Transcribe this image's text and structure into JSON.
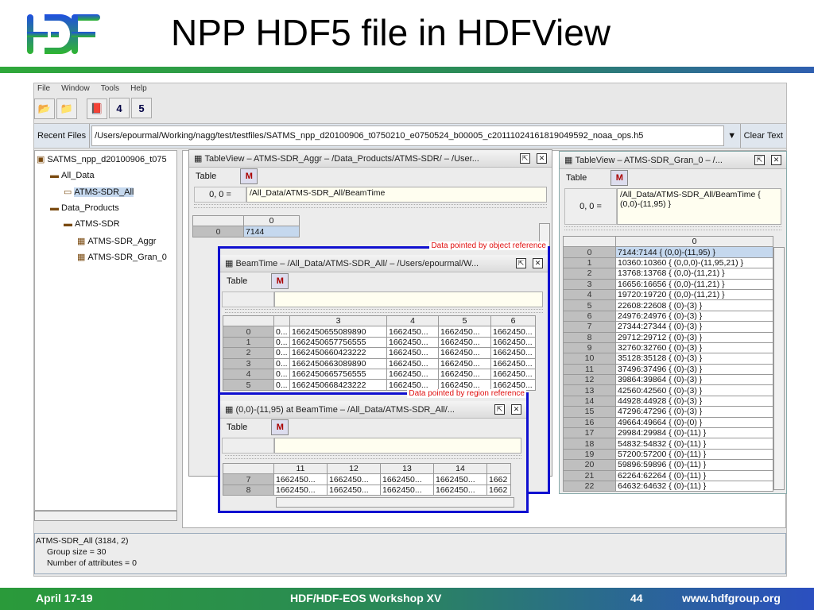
{
  "slide": {
    "title": "NPP HDF5 file in HDFView",
    "logo_text": "HDF",
    "footer": {
      "date": "April 17-19",
      "event": "HDF/HDF-EOS Workshop XV",
      "page": "44",
      "url": "www.hdfgroup.org"
    }
  },
  "app": {
    "menu": [
      "File",
      "Window",
      "Tools",
      "Help"
    ],
    "toolbar": [
      "open-file-icon",
      "new-file-icon",
      "help-book-icon",
      "hdf4-icon",
      "hdf5-icon"
    ],
    "recent_label": "Recent Files",
    "recent_value": "/Users/epourmal/Working/nagg/test/testfiles/SATMS_npp_d20100906_t0750210_e0750524_b00005_c20111024161819049592_noaa_ops.h5",
    "clear_label": "Clear Text",
    "tree": [
      {
        "label": "SATMS_npp_d20100906_t075",
        "level": 0,
        "icon": "hdf5-file-icon"
      },
      {
        "label": "All_Data",
        "level": 1,
        "icon": "folder-icon"
      },
      {
        "label": "ATMS-SDR_All",
        "level": 2,
        "icon": "folder-open-icon",
        "selected": true
      },
      {
        "label": "Data_Products",
        "level": 1,
        "icon": "folder-icon"
      },
      {
        "label": "ATMS-SDR",
        "level": 2,
        "icon": "folder-attr-icon"
      },
      {
        "label": "ATMS-SDR_Aggr",
        "level": 3,
        "icon": "dataset-icon"
      },
      {
        "label": "ATMS-SDR_Gran_0",
        "level": 3,
        "icon": "dataset-icon"
      }
    ],
    "info": [
      "ATMS-SDR_All (3184, 2)",
      "Group size = 30",
      "Number of attributes = 0"
    ]
  },
  "windows": {
    "aggr": {
      "title": "TableView  –  ATMS-SDR_Aggr  –  /Data_Products/ATMS-SDR/  –  /User...",
      "menu": "Table",
      "cell_label": "0, 0  =",
      "cell_value": "/All_Data/ATMS-SDR_All/BeamTime",
      "col": "0",
      "row": "0",
      "value": "7144"
    },
    "beam": {
      "ref_label": "Data pointed by object reference",
      "title": "BeamTime  –  /All_Data/ATMS-SDR_All/  –  /Users/epourmal/W...",
      "menu": "Table",
      "cols": [
        "",
        "3",
        "4",
        "5",
        "6"
      ],
      "rows": [
        [
          "0",
          "0...",
          "1662450655089890",
          "1662450...",
          "1662450...",
          "1662450..."
        ],
        [
          "1",
          "0...",
          "1662450657756555",
          "1662450...",
          "1662450...",
          "1662450..."
        ],
        [
          "2",
          "0...",
          "1662450660423222",
          "1662450...",
          "1662450...",
          "1662450..."
        ],
        [
          "3",
          "0...",
          "1662450663089890",
          "1662450...",
          "1662450...",
          "1662450..."
        ],
        [
          "4",
          "0...",
          "1662450665756555",
          "1662450...",
          "1662450...",
          "1662450..."
        ],
        [
          "5",
          "0...",
          "1662450668423222",
          "1662450...",
          "1662450...",
          "1662450..."
        ]
      ]
    },
    "region": {
      "ref_label": "Data pointed by region reference",
      "title": "(0,0)-(11,95) at BeamTime  –  /All_Data/ATMS-SDR_All/...",
      "menu": "Table",
      "cols": [
        "11",
        "12",
        "13",
        "14",
        ""
      ],
      "rows": [
        [
          "7",
          "1662450...",
          "1662450...",
          "1662450...",
          "1662450...",
          "1662"
        ],
        [
          "8",
          "1662450...",
          "1662450...",
          "1662450...",
          "1662450...",
          "1662"
        ]
      ]
    },
    "gran": {
      "title": "TableView  –  ATMS-SDR_Gran_0  –  /...",
      "menu": "Table",
      "cell_label": "0, 0  =",
      "cell_value": "/All_Data/ATMS-SDR_All/BeamTime { (0,0)-(11,95) }",
      "col": "0",
      "rows": [
        "7144:7144 { (0,0)-(11,95) }",
        "10360:10360 { (0,0,0)-(11,95,21) }",
        "13768:13768 { (0,0)-(11,21) }",
        "16656:16656 { (0,0)-(11,21) }",
        "19720:19720 { (0,0)-(11,21) }",
        "22608:22608 { (0)-(3) }",
        "24976:24976 { (0)-(3) }",
        "27344:27344 { (0)-(3) }",
        "29712:29712 { (0)-(3) }",
        "32760:32760 { (0)-(3) }",
        "35128:35128 { (0)-(3) }",
        "37496:37496 { (0)-(3) }",
        "39864:39864 { (0)-(3) }",
        "42560:42560 { (0)-(3) }",
        "44928:44928 { (0)-(3) }",
        "47296:47296 { (0)-(3) }",
        "49664:49664 { (0)-(0) }",
        "29984:29984 { (0)-(11) }",
        "54832:54832 { (0)-(11) }",
        "57200:57200 { (0)-(11) }",
        "59896:59896 { (0)-(11) }",
        "62264:62264 { (0)-(11) }",
        "64632:64632 { (0)-(11) }"
      ]
    }
  }
}
